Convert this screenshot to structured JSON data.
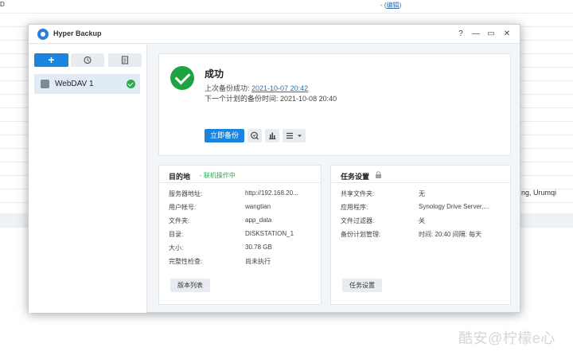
{
  "background": {
    "top_left_text": "D",
    "top_mid_prefix": "- (",
    "top_mid_link": "编辑",
    "top_mid_suffix": ")",
    "right_text": "ng, Urumqi",
    "watermark": "酷安@柠檬e心"
  },
  "window": {
    "title": "Hyper Backup",
    "help_label": "?",
    "minimize_label": "—",
    "maximize_label": "▭",
    "close_label": "✕"
  },
  "sidebar": {
    "add_label": "+",
    "history_icon": "history-icon",
    "log_icon": "log-icon",
    "task_name": "WebDAV 1"
  },
  "status": {
    "title": "成功",
    "last_backup_label": "上次备份成功:",
    "last_backup_value": "2021-10-07 20:42",
    "next_backup_label": "下一个计划的备份时间:",
    "next_backup_value": "2021-10-08 20:40",
    "backup_now_label": "立即备份"
  },
  "destination": {
    "title": "目的地",
    "status": "- 联机操作中",
    "rows": [
      {
        "key": "服务器地址:",
        "value": "http://192.168.20..."
      },
      {
        "key": "用户帐号:",
        "value": "wangtian"
      },
      {
        "key": "文件夹:",
        "value": "app_data"
      },
      {
        "key": "目录:",
        "value": "DISKSTATION_1"
      },
      {
        "key": "大小:",
        "value": "30.78 GB"
      },
      {
        "key": "完整性检查:",
        "value": "尚未执行"
      }
    ],
    "button_label": "版本列表"
  },
  "task_settings": {
    "title": "任务设置",
    "rows": [
      {
        "key": "共享文件夹:",
        "value": "无"
      },
      {
        "key": "应用程序:",
        "value": "Synology Drive Server,..."
      },
      {
        "key": "文件过滤器:",
        "value": "关"
      },
      {
        "key": "备份计划管理:",
        "value": "时间: 20:40 间隔: 每天"
      }
    ],
    "button_label": "任务设置"
  },
  "colors": {
    "accent": "#1a85e0",
    "success": "#1ea341",
    "online": "#2ea84f"
  }
}
